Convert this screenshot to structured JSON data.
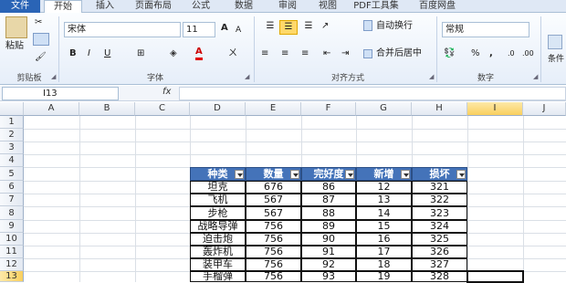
{
  "tabs": [
    "文件",
    "开始",
    "插入",
    "页面布局",
    "公式",
    "数据",
    "审阅",
    "视图",
    "PDF工具集",
    "百度网盘"
  ],
  "ribbon": {
    "clipboard": {
      "paste": "粘贴",
      "label": "剪贴板"
    },
    "font": {
      "name": "宋体",
      "size": "11",
      "bold": "B",
      "italic": "I",
      "underline": "U",
      "grow": "A",
      "shrink": "A",
      "label": "字体"
    },
    "align": {
      "wrap": "自动换行",
      "merge": "合并后居中",
      "label": "对齐方式"
    },
    "number": {
      "format": "常规",
      "percent": "%",
      "comma": ",",
      "label": "数字"
    },
    "styles": {
      "cond": "条件"
    }
  },
  "formula_bar": {
    "cell_ref": "I13",
    "fx": "fx",
    "value": ""
  },
  "columns": [
    "A",
    "B",
    "C",
    "D",
    "E",
    "F",
    "G",
    "H",
    "I",
    "J"
  ],
  "rows": [
    "1",
    "2",
    "3",
    "4",
    "5",
    "6",
    "7",
    "8",
    "9",
    "10",
    "11",
    "12",
    "13"
  ],
  "table": {
    "headers": [
      "种类",
      "数量",
      "完好度",
      "新增",
      "损坏"
    ],
    "rows": [
      [
        "坦克",
        "676",
        "86",
        "12",
        "321"
      ],
      [
        "飞机",
        "567",
        "87",
        "13",
        "322"
      ],
      [
        "步枪",
        "567",
        "88",
        "14",
        "323"
      ],
      [
        "战略导弹",
        "756",
        "89",
        "15",
        "324"
      ],
      [
        "迫击炮",
        "756",
        "90",
        "16",
        "325"
      ],
      [
        "轰炸机",
        "756",
        "91",
        "17",
        "326"
      ],
      [
        "装甲车",
        "756",
        "92",
        "18",
        "327"
      ],
      [
        "手榴弹",
        "756",
        "93",
        "19",
        "328"
      ]
    ]
  }
}
